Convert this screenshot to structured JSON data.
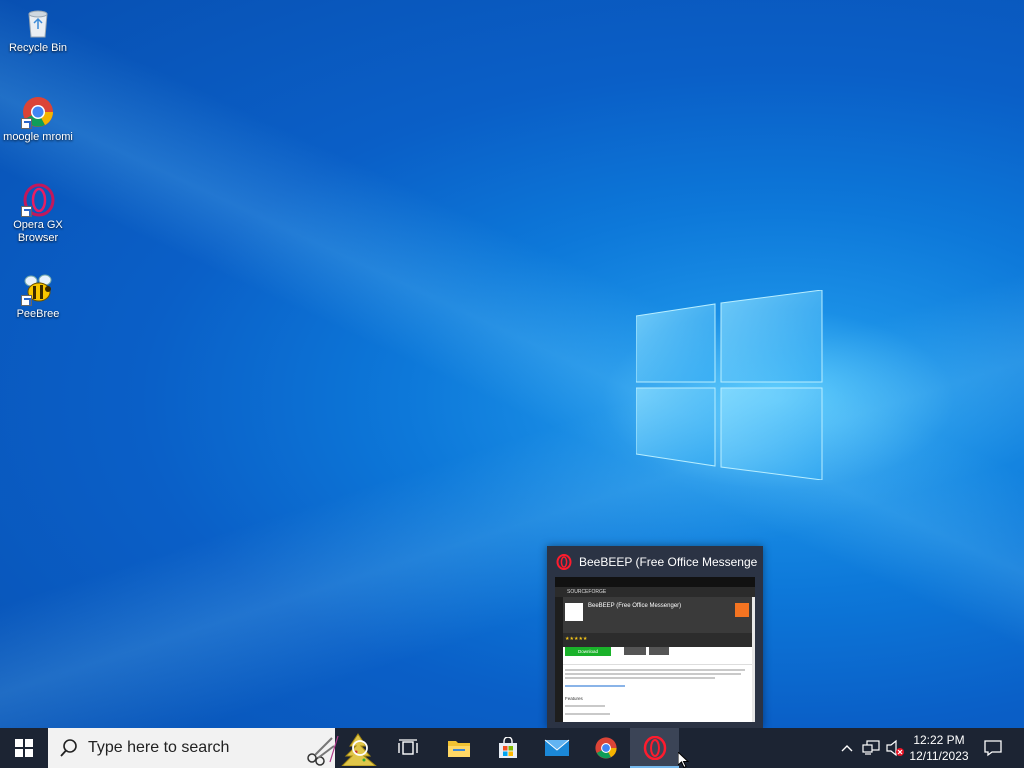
{
  "desktop": {
    "icons": [
      {
        "label": "Recycle Bin",
        "icon": "recycle-bin-icon"
      },
      {
        "label": "moogle mromi",
        "icon": "chrome-icon"
      },
      {
        "label": "Opera GX Browser",
        "label_line1": "Opera GX",
        "label_line2": "Browser",
        "icon": "opera-gx-icon"
      },
      {
        "label": "PeeBree",
        "icon": "beebeep-icon"
      }
    ]
  },
  "preview": {
    "title": "BeeBEEP (Free Office Messenge...",
    "page": {
      "site": "SOURCEFORGE",
      "app_name": "BeeBEEP (Free Office Messenger)",
      "download": "Download",
      "features": "Features"
    }
  },
  "taskbar": {
    "search_placeholder": "Type here to search",
    "apps": [
      "File Explorer",
      "Microsoft Store",
      "Mail",
      "Google Chrome",
      "Opera"
    ],
    "clock_time": "12:22 PM",
    "clock_date": "12/11/2023"
  },
  "colors": {
    "taskbar_bg": "#1c2433",
    "active_underline": "#76b9ed",
    "desktop_blue": "#0a5fc7"
  }
}
